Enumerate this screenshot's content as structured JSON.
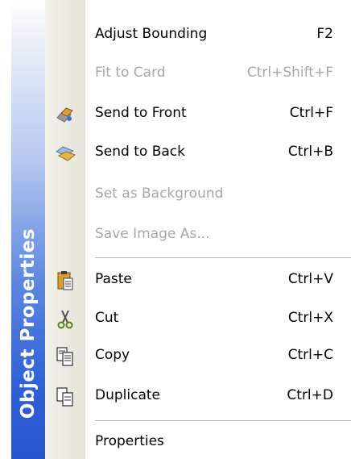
{
  "banner": {
    "title": "Object Properties"
  },
  "menu": {
    "items": [
      {
        "label": "Adjust Bounding",
        "shortcut": "F2",
        "enabled": true,
        "icon": null
      },
      {
        "label": "Fit to Card",
        "shortcut": "Ctrl+Shift+F",
        "enabled": false,
        "icon": null
      },
      {
        "label": "Send to Front",
        "shortcut": "Ctrl+F",
        "enabled": true,
        "icon": "bring-to-front-icon"
      },
      {
        "label": "Send to Back",
        "shortcut": "Ctrl+B",
        "enabled": true,
        "icon": "send-to-back-icon"
      },
      {
        "label": "Set as Background",
        "shortcut": "",
        "enabled": false,
        "icon": null
      },
      {
        "label": "Save Image As...",
        "shortcut": "",
        "enabled": false,
        "icon": null
      },
      {
        "label": "Paste",
        "shortcut": "Ctrl+V",
        "enabled": true,
        "icon": "paste-icon"
      },
      {
        "label": "Cut",
        "shortcut": "Ctrl+X",
        "enabled": true,
        "icon": "scissors-icon"
      },
      {
        "label": "Copy",
        "shortcut": "Ctrl+C",
        "enabled": true,
        "icon": "copy-icon"
      },
      {
        "label": "Duplicate",
        "shortcut": "Ctrl+D",
        "enabled": true,
        "icon": "duplicate-icon"
      },
      {
        "label": "Properties",
        "shortcut": "",
        "enabled": true,
        "icon": null
      }
    ]
  },
  "colors": {
    "banner_dark": "#2856cf",
    "banner_light": "#ffffff",
    "disabled_text": "#a8a8a0",
    "icon_column": "#e6e4d8"
  }
}
